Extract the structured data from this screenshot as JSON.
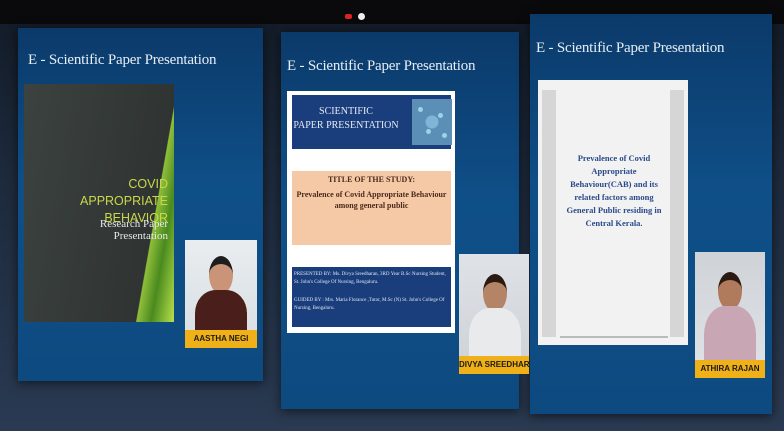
{
  "slides": [
    {
      "title": "E - Scientific Paper Presentation",
      "heading_line1": "COVID APPROPRIATE",
      "heading_line2": "BEHAVIOR",
      "subtitle": "Research Paper Presentation"
    },
    {
      "title": "E - Scientific Paper Presentation",
      "banner_line1": "SCIENTIFIC",
      "banner_line2": "PAPER PRESENTATION",
      "study_label": "TITLE OF THE STUDY:",
      "study_title": "Prevalence of Covid Appropriate Behaviour among general public",
      "presented_by": "PRESENTED BY: Ms. Divya Sreedharan, 3RD Year B.Sc Nursing Student, St. John's College Of Nursing, Bengaluru.",
      "guided_by": "GUIDED BY : Mrs. Maria Florance ,Tutor, M.Sc (N) St. John's College Of Nursing, Bengaluru."
    },
    {
      "title": "E - Scientific Paper Presentation",
      "doc_text": "Prevalence of Covid Appropriate Behaviour(CAB) and its related factors among General Public residing in Central Kerala."
    }
  ],
  "participants": [
    {
      "name": "AASTHA NEGI"
    },
    {
      "name": "DIVYA SREEDHARAN"
    },
    {
      "name": "ATHIRA RAJAN"
    }
  ],
  "colors": {
    "slide_bg": "#0f4f88",
    "nametag": "#f0b018",
    "accent_green": "#8fbf3a",
    "banner_blue": "#1a3d7c",
    "peach": "#f6c9a6"
  }
}
